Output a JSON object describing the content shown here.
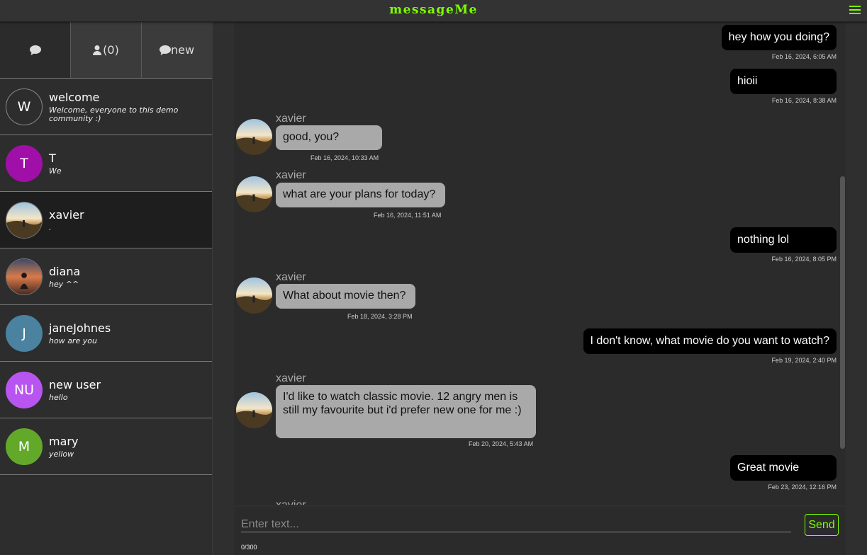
{
  "app": {
    "title": "messageMe"
  },
  "sidebar": {
    "tabs": {
      "contacts_count": "(0)",
      "new_label": "new"
    },
    "conversations": [
      {
        "initials": "W",
        "name": "welcome",
        "preview": "Welcome, everyone to this demo community :)",
        "color": "#2d2d2d"
      },
      {
        "initials": "T",
        "name": "T",
        "preview": "We",
        "color": "#a010a8"
      },
      {
        "initials": "",
        "name": "xavier",
        "preview": ".",
        "photo": "landscape"
      },
      {
        "initials": "",
        "name": "diana",
        "preview": "hey ^^",
        "photo": "sunset"
      },
      {
        "initials": "J",
        "name": "janeJohnes",
        "preview": "how are you",
        "color": "#4a82a0"
      },
      {
        "initials": "NU",
        "name": "new user",
        "preview": "hello",
        "color": "#b855f0"
      },
      {
        "initials": "M",
        "name": "mary",
        "preview": "yellow",
        "color": "#62a92a"
      }
    ]
  },
  "messages": [
    {
      "dir": "out",
      "text": "hey how you doing?",
      "time": "Feb 16, 2024, 6:05 AM"
    },
    {
      "dir": "out",
      "text": "hioii",
      "time": "Feb 16, 2024, 8:38 AM"
    },
    {
      "dir": "in",
      "sender": "xavier",
      "text": "good, you?",
      "time": "Feb 16, 2024, 10:33 AM"
    },
    {
      "dir": "in",
      "sender": "xavier",
      "text": "what are your plans for today?",
      "time": "Feb 16, 2024, 11:51 AM"
    },
    {
      "dir": "out",
      "text": "nothing lol",
      "time": "Feb 16, 2024, 8:05 PM"
    },
    {
      "dir": "in",
      "sender": "xavier",
      "text": "What about movie then?",
      "time": "Feb 18, 2024, 3:28 PM"
    },
    {
      "dir": "out",
      "text": "I don't know, what movie do you want to watch?",
      "time": "Feb 19, 2024, 2:40 PM"
    },
    {
      "dir": "in",
      "sender": "xavier",
      "text": "I'd like to watch classic movie. 12 angry men is still my favourite but i'd prefer new one for me :)",
      "time": "Feb 20, 2024, 5:43 AM"
    },
    {
      "dir": "out",
      "text": "Great movie",
      "time": "Feb 23, 2024, 12:16 PM"
    },
    {
      "dir": "in",
      "sender": "xavier",
      "text": "",
      "time": ""
    }
  ],
  "composer": {
    "placeholder": "Enter text...",
    "send_label": "Send",
    "char_count": "0/300"
  },
  "colors": {
    "accent": "#7fff00",
    "bubble_out": "#000000",
    "bubble_in": "#a9a9a9"
  }
}
